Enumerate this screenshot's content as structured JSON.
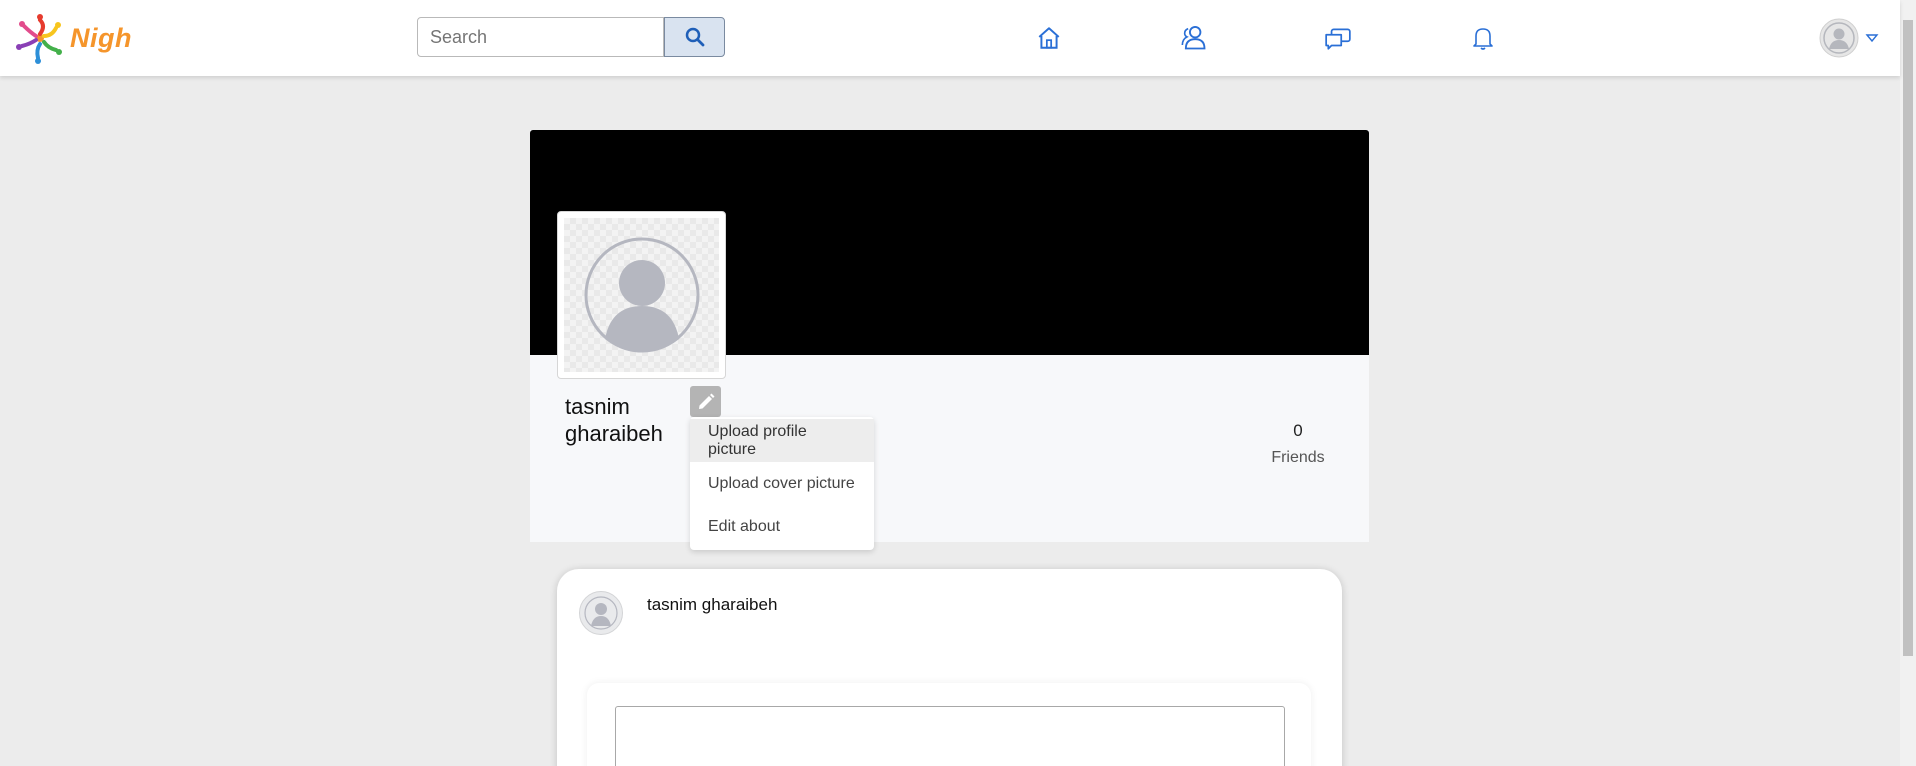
{
  "brand": {
    "name": "Nigh"
  },
  "search": {
    "placeholder": "Search",
    "value": ""
  },
  "nav": {
    "icons": [
      "home-icon",
      "friends-icon",
      "messages-icon",
      "notifications-icon"
    ],
    "accent": "#2a6fd6"
  },
  "profile": {
    "first_name": "tasnim",
    "last_name": "gharaibeh",
    "friends_count": "0",
    "friends_label": "Friends"
  },
  "dropdown": {
    "items": [
      "Upload profile picture",
      "Upload cover picture",
      "Edit about"
    ]
  },
  "post": {
    "author": "tasnim gharaibeh",
    "text": ""
  },
  "colors": {
    "page_bg": "#ececec",
    "cover_bg": "#000000",
    "logo": "#f5952b"
  }
}
